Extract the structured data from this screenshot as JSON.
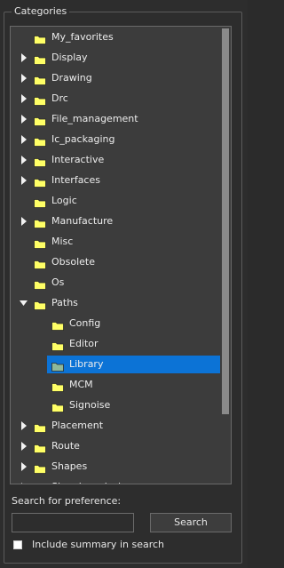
{
  "group": {
    "title": "Categories"
  },
  "tree": {
    "items": [
      {
        "label": "My_favorites",
        "depth": 0,
        "expander": "none",
        "selected": false
      },
      {
        "label": "Display",
        "depth": 0,
        "expander": "collapsed",
        "selected": false
      },
      {
        "label": "Drawing",
        "depth": 0,
        "expander": "collapsed",
        "selected": false
      },
      {
        "label": "Drc",
        "depth": 0,
        "expander": "collapsed",
        "selected": false
      },
      {
        "label": "File_management",
        "depth": 0,
        "expander": "collapsed",
        "selected": false
      },
      {
        "label": "Ic_packaging",
        "depth": 0,
        "expander": "collapsed",
        "selected": false
      },
      {
        "label": "Interactive",
        "depth": 0,
        "expander": "collapsed",
        "selected": false
      },
      {
        "label": "Interfaces",
        "depth": 0,
        "expander": "collapsed",
        "selected": false
      },
      {
        "label": "Logic",
        "depth": 0,
        "expander": "none",
        "selected": false
      },
      {
        "label": "Manufacture",
        "depth": 0,
        "expander": "collapsed",
        "selected": false
      },
      {
        "label": "Misc",
        "depth": 0,
        "expander": "none",
        "selected": false
      },
      {
        "label": "Obsolete",
        "depth": 0,
        "expander": "none",
        "selected": false
      },
      {
        "label": "Os",
        "depth": 0,
        "expander": "none",
        "selected": false
      },
      {
        "label": "Paths",
        "depth": 0,
        "expander": "expanded",
        "selected": false
      },
      {
        "label": "Config",
        "depth": 1,
        "expander": "none",
        "selected": false
      },
      {
        "label": "Editor",
        "depth": 1,
        "expander": "none",
        "selected": false
      },
      {
        "label": "Library",
        "depth": 1,
        "expander": "none",
        "selected": true
      },
      {
        "label": "MCM",
        "depth": 1,
        "expander": "none",
        "selected": false
      },
      {
        "label": "Signoise",
        "depth": 1,
        "expander": "none",
        "selected": false
      },
      {
        "label": "Placement",
        "depth": 0,
        "expander": "collapsed",
        "selected": false
      },
      {
        "label": "Route",
        "depth": 0,
        "expander": "collapsed",
        "selected": false
      },
      {
        "label": "Shapes",
        "depth": 0,
        "expander": "collapsed",
        "selected": false
      },
      {
        "label": "Signal_analysis",
        "depth": 0,
        "expander": "collapsed",
        "selected": false
      }
    ],
    "icons": {
      "folder": "folder-icon",
      "collapsed": "chevron-right-icon",
      "expanded": "chevron-down-icon"
    }
  },
  "search": {
    "label": "Search for preference:",
    "input_value": "",
    "button_label": "Search"
  },
  "summary": {
    "checkbox_label": "Include summary in search",
    "checked": false
  },
  "colors": {
    "panel_bg": "#2d2d2d",
    "tree_bg": "#3c3c3c",
    "selection": "#0c73d6",
    "folder_yellow": "#ffff66",
    "folder_selected": "#8fb99a"
  }
}
